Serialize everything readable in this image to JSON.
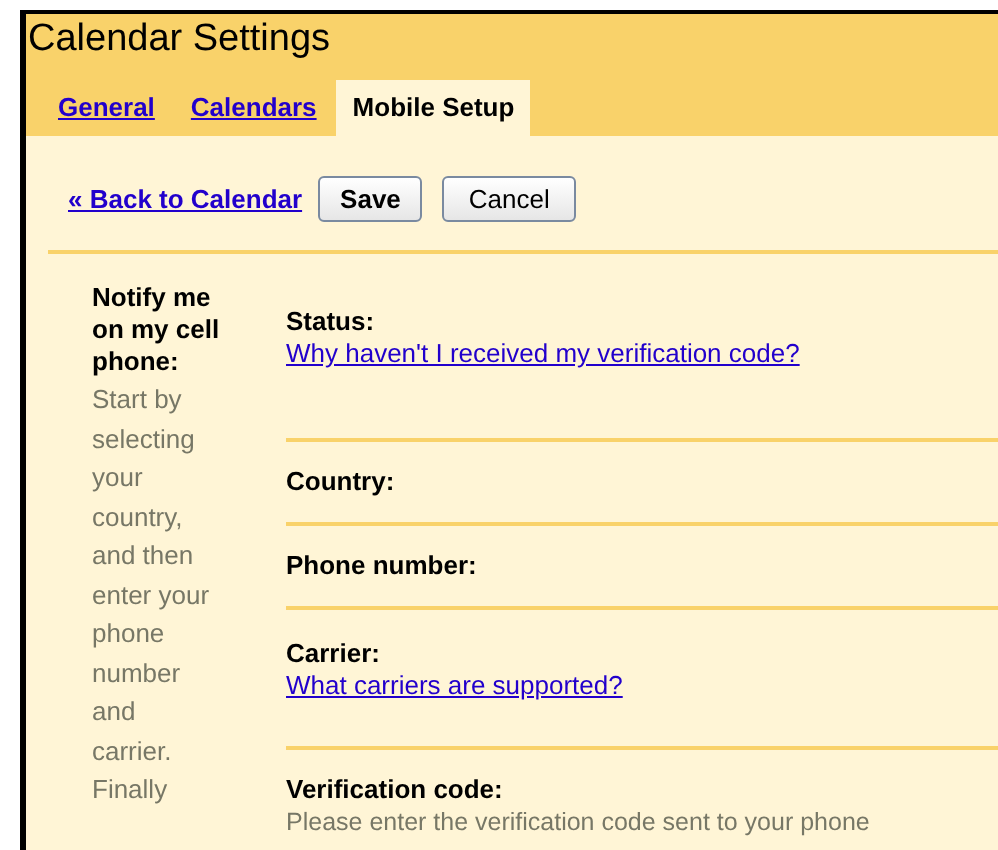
{
  "window": {
    "title": "Calendar Settings"
  },
  "tabs": [
    {
      "label": "General",
      "selected": false
    },
    {
      "label": "Calendars",
      "selected": false
    },
    {
      "label": "Mobile Setup",
      "selected": true
    }
  ],
  "toolbar": {
    "back_link": "« Back to Calendar",
    "buttons": [
      {
        "label": "Save",
        "primary": true
      },
      {
        "label": "Cancel",
        "primary": false
      }
    ]
  },
  "section": {
    "heading": "Notify me on my cell phone:",
    "description": "Start by selecting your country, and then enter your phone number and carrier. Finally",
    "fields": [
      {
        "label": "Status:",
        "link": "Why haven't I received my verification code?"
      },
      {
        "label": "Country:"
      },
      {
        "label": "Phone number:"
      },
      {
        "label": "Carrier:",
        "link": "What carriers are supported?"
      },
      {
        "label": "Verification code:",
        "hint": "Please enter the verification code sent to your phone"
      }
    ]
  }
}
